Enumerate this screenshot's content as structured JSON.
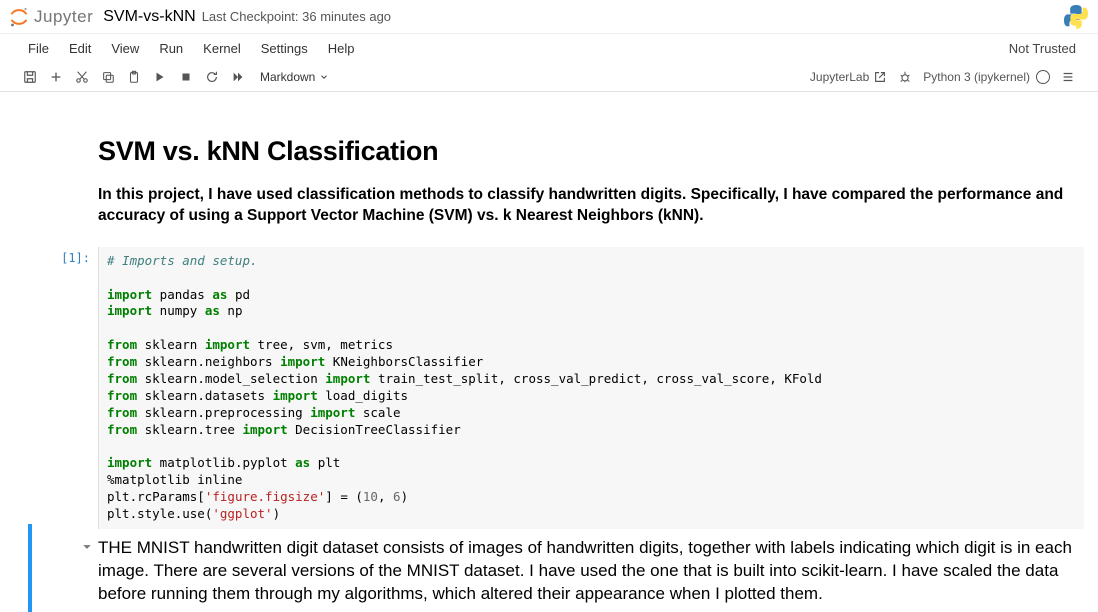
{
  "header": {
    "logo_text": "Jupyter",
    "notebook_name": "SVM-vs-kNN",
    "checkpoint": "Last Checkpoint: 36 minutes ago"
  },
  "menubar": {
    "items": [
      "File",
      "Edit",
      "View",
      "Run",
      "Kernel",
      "Settings",
      "Help"
    ],
    "trust": "Not Trusted"
  },
  "toolbar": {
    "cell_type": "Markdown",
    "jupyterlab": "JupyterLab",
    "kernel": "Python 3 (ipykernel)"
  },
  "cells": {
    "md1_title": "SVM vs. kNN Classification",
    "md1_sub": "In this project, I have used classification methods to classify handwritten digits. Specifically, I have compared the performance and accuracy of using a Support Vector Machine (SVM) vs. k Nearest Neighbors (kNN).",
    "code1_prompt": "[1]:",
    "code1_lines": {
      "l0": "# Imports and setup.",
      "l1_1": "import",
      "l1_2": " pandas ",
      "l1_3": "as",
      "l1_4": " pd",
      "l2_1": "import",
      "l2_2": " numpy ",
      "l2_3": "as",
      "l2_4": " np",
      "l3_1": "from",
      "l3_2": " sklearn ",
      "l3_3": "import",
      "l3_4": " tree, svm, metrics",
      "l4_1": "from",
      "l4_2": " sklearn.neighbors ",
      "l4_3": "import",
      "l4_4": " KNeighborsClassifier",
      "l5_1": "from",
      "l5_2": " sklearn.model_selection ",
      "l5_3": "import",
      "l5_4": " train_test_split, cross_val_predict, cross_val_score, KFold",
      "l6_1": "from",
      "l6_2": " sklearn.datasets ",
      "l6_3": "import",
      "l6_4": " load_digits",
      "l7_1": "from",
      "l7_2": " sklearn.preprocessing ",
      "l7_3": "import",
      "l7_4": " scale",
      "l8_1": "from",
      "l8_2": " sklearn.tree ",
      "l8_3": "import",
      "l8_4": " DecisionTreeClassifier",
      "l9_1": "import",
      "l9_2": " matplotlib.pyplot ",
      "l9_3": "as",
      "l9_4": " plt",
      "l10": "%matplotlib inline",
      "l11_1": "plt.rcParams[",
      "l11_2": "'figure.figsize'",
      "l11_3": "] = (",
      "l11_4": "10",
      "l11_5": ", ",
      "l11_6": "6",
      "l11_7": ")",
      "l12_1": "plt.style.use(",
      "l12_2": "'ggplot'",
      "l12_3": ")"
    },
    "md2": "THE MNIST handwritten digit dataset consists of images of handwritten digits, together with labels indicating which digit is in each image. There are several versions of the MNIST dataset. I have used the one that is built into scikit-learn. I have scaled the data before running them through my algorithms, which altered their appearance when I plotted them."
  }
}
